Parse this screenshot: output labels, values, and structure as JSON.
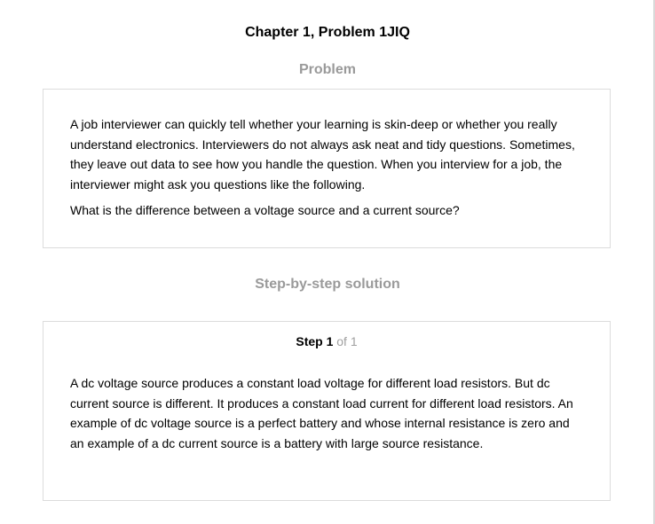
{
  "chapter_title": "Chapter 1, Problem 1JIQ",
  "problem": {
    "heading": "Problem",
    "paragraphs": [
      "A job interviewer can quickly tell whether your learning is skin-deep or whether you really understand electronics. Interviewers do not always ask neat and tidy questions. Sometimes, they leave out data to see how you handle the question. When you interview for a job, the interviewer might ask you questions like the following.",
      "What is the difference between a voltage source and a current source?"
    ]
  },
  "solution": {
    "heading": "Step-by-step solution",
    "step_label": "Step 1",
    "step_of": "of 1",
    "paragraphs": [
      "A dc voltage source produces a constant load voltage for different load resistors. But dc current source is different. It produces a constant load current for different load resistors. An example of dc voltage source is a perfect battery and whose internal resistance is zero and an example of a dc current source is a battery with large source resistance."
    ]
  }
}
